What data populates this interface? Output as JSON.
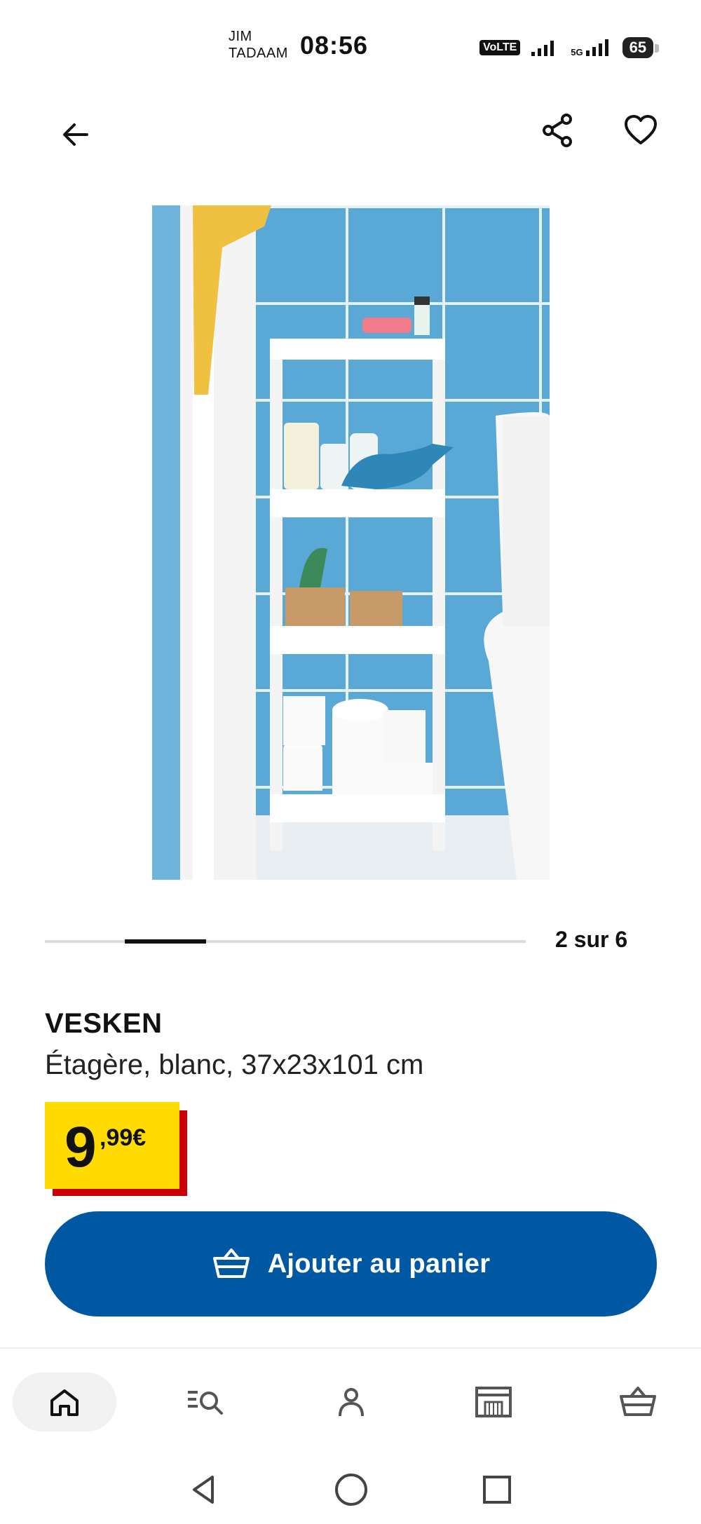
{
  "status_bar": {
    "carrier_line1": "JIM",
    "carrier_line2": "TADAAM",
    "time": "08:56",
    "volte": "VoLTE",
    "network": "5G",
    "battery": "65"
  },
  "header": {
    "back_icon": "arrow-left-icon",
    "share_icon": "share-icon",
    "favorite_icon": "heart-icon"
  },
  "carousel": {
    "page_label": "2 sur 6",
    "current": 2,
    "total": 6
  },
  "product": {
    "name": "VESKEN",
    "description": "Étagère, blanc, 37x23x101 cm",
    "price_integer": "9",
    "price_decimal": ",99€"
  },
  "cart_button": {
    "label": "Ajouter au panier",
    "icon": "basket-icon"
  },
  "bottom_nav": {
    "items": [
      {
        "icon": "home-icon",
        "active": true
      },
      {
        "icon": "search-list-icon",
        "active": false
      },
      {
        "icon": "profile-icon",
        "active": false
      },
      {
        "icon": "store-icon",
        "active": false
      },
      {
        "icon": "basket-icon",
        "active": false
      }
    ]
  },
  "system_nav": {
    "back": "triangle-back-icon",
    "home": "circle-home-icon",
    "recents": "square-recents-icon"
  },
  "colors": {
    "brand_blue": "#0058a3",
    "price_yellow": "#ffdb00",
    "price_red": "#cc0008",
    "tile_blue": "#5aa8d6"
  }
}
